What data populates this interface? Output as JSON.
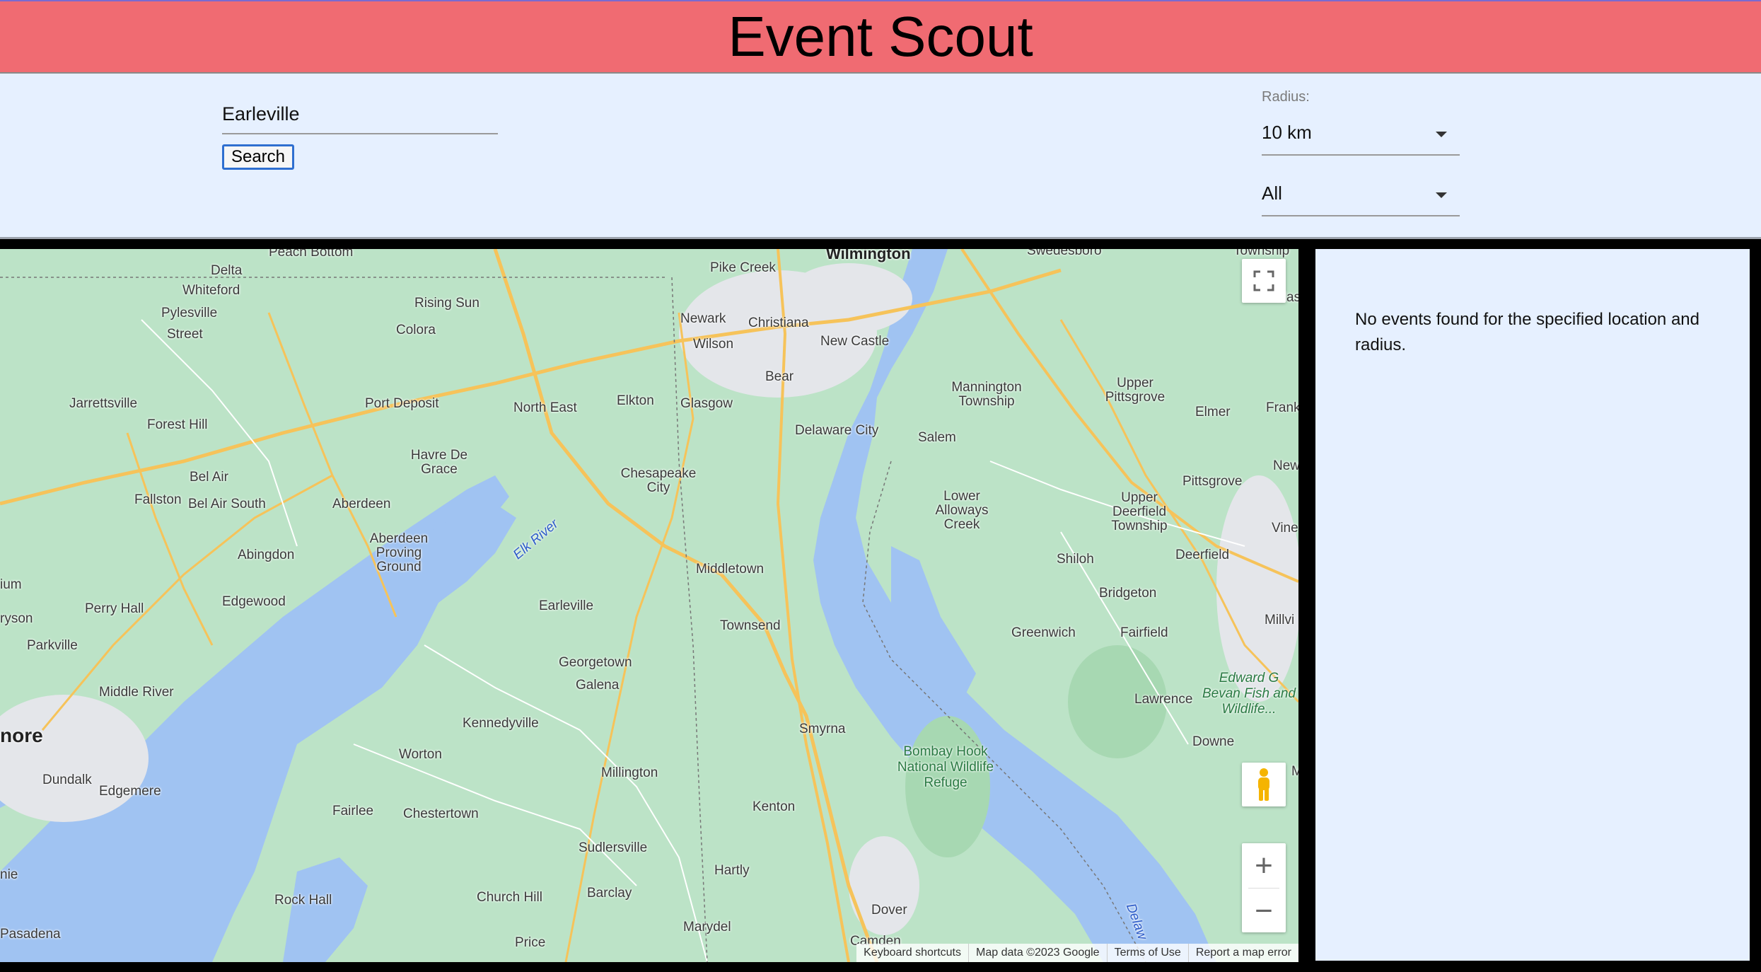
{
  "header": {
    "title": "Event Scout"
  },
  "search": {
    "value": "Earleville",
    "button_label": "Search"
  },
  "filters": {
    "radius_label": "Radius:",
    "radius_value": "10 km",
    "category_value": "All"
  },
  "map": {
    "labels": [
      "Wilmington",
      "Pike Creek",
      "Newark",
      "Christiana",
      "Wilson",
      "New Castle",
      "Bear",
      "Glasgow",
      "Elkton",
      "North East",
      "Rising Sun",
      "Colora",
      "Port Deposit",
      "Delta",
      "Whiteford",
      "Pylesville",
      "Street",
      "Jarrettsville",
      "Forest Hill",
      "Havre De Grace",
      "Bel Air",
      "Fallston",
      "Bel Air South",
      "Aberdeen",
      "Abingdon",
      "Aberdeen Proving Ground",
      "Edgewood",
      "Perry Hall",
      "Parkville",
      "Middle River",
      "Dundalk",
      "Edgemere",
      "Pasadena",
      "Rock Hall",
      "Fairlee",
      "Chestertown",
      "Worton",
      "Kennedyville",
      "Galena",
      "Georgetown",
      "Earleville",
      "Chesapeake City",
      "Middletown",
      "Townsend",
      "Millington",
      "Sudlersville",
      "Barclay",
      "Church Hill",
      "Price",
      "Marydel",
      "Hartly",
      "Kenton",
      "Smyrna",
      "Dover",
      "Camden",
      "Delaware City",
      "Salem",
      "Mannington Township",
      "Upper Pittsgrove",
      "Elmer",
      "Pittsgrove",
      "Lower Alloways Creek",
      "Upper Deerfield Township",
      "Deerfield",
      "Shiloh",
      "Bridgeton",
      "Greenwich",
      "Fairfield",
      "Lawrence",
      "Downe",
      "Swedesboro",
      "Glassbo",
      "Frank",
      "New",
      "Vine",
      "Millvi"
    ],
    "water_labels": [
      "Elk River",
      "Delaw"
    ],
    "park_labels": [
      "Bombay Hook National Wildlife Refuge",
      "Edward G Bevan Fish and Wildlife..."
    ],
    "big_labels": [
      "nore"
    ],
    "edge_labels": [
      "Peach Bottom",
      "Township",
      "ium",
      "ryson",
      "nie",
      "M"
    ],
    "attribution": {
      "shortcuts": "Keyboard shortcuts",
      "data": "Map data ©2023 Google",
      "terms": "Terms of Use",
      "report": "Report a map error"
    },
    "controls": {
      "zoom_in": "+",
      "zoom_out": "−"
    }
  },
  "results": {
    "message": "No events found for the specified location and radius."
  }
}
